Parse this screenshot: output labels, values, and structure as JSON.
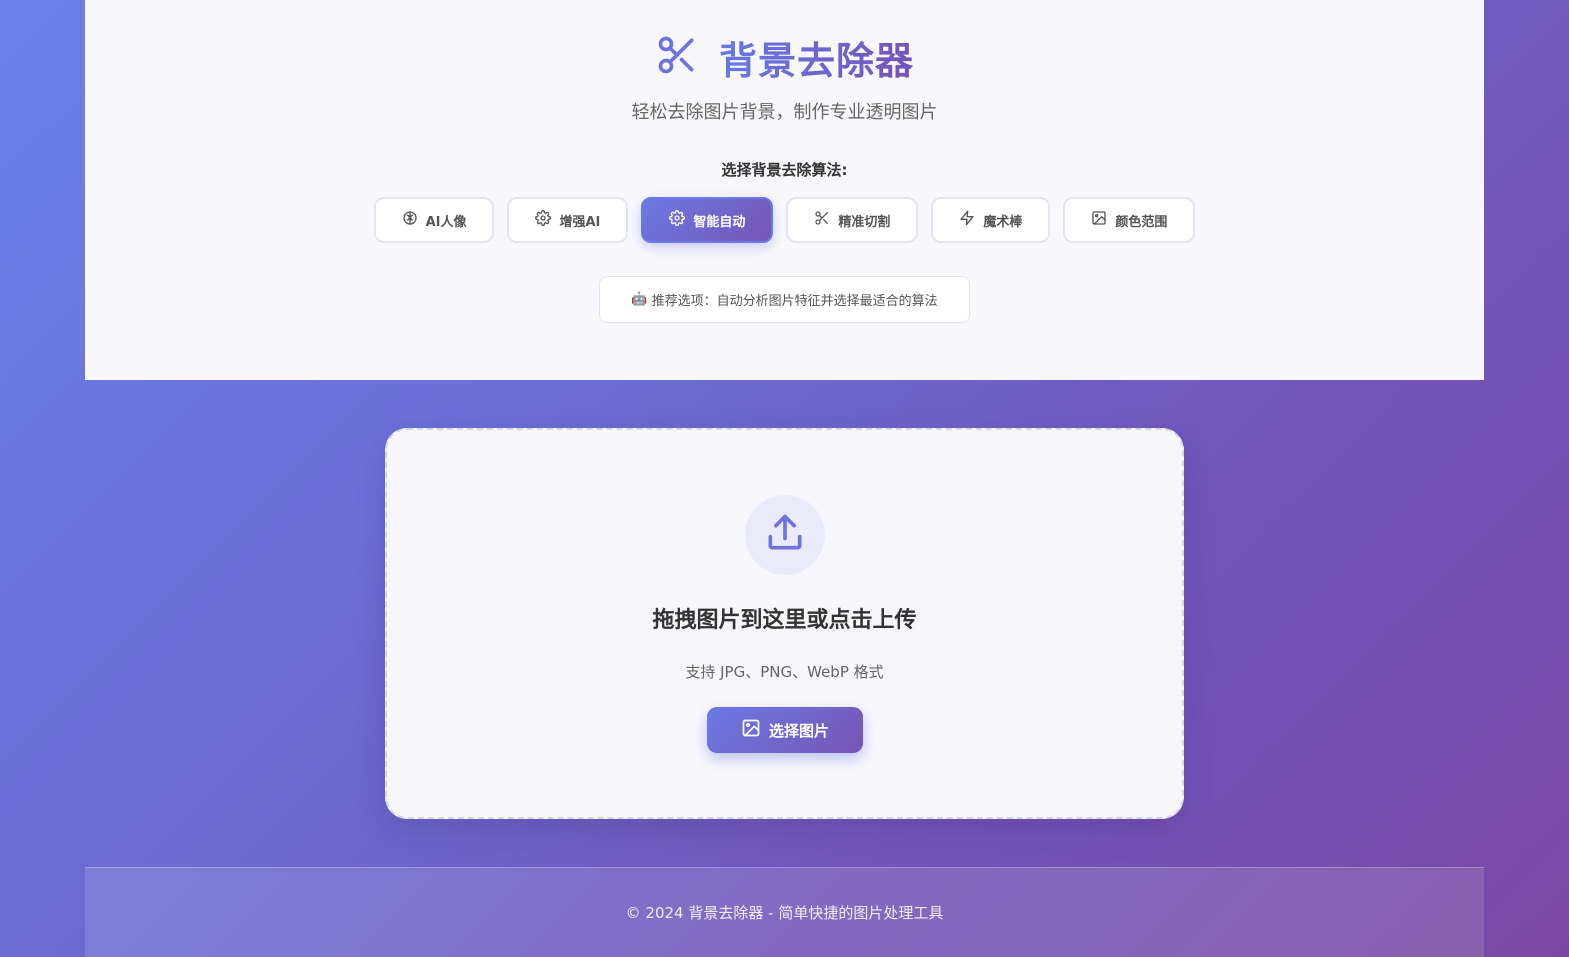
{
  "header": {
    "title": "背景去除器",
    "subtitle": "轻松去除图片背景，制作专业透明图片",
    "algo_label": "选择背景去除算法:",
    "algorithms": [
      {
        "label": "AI人像",
        "icon": "brain-icon",
        "active": false
      },
      {
        "label": "增强AI",
        "icon": "gear-icon",
        "active": false
      },
      {
        "label": "智能自动",
        "icon": "gear-icon",
        "active": true
      },
      {
        "label": "精准切割",
        "icon": "scissors-icon",
        "active": false
      },
      {
        "label": "魔术棒",
        "icon": "lightning-icon",
        "active": false
      },
      {
        "label": "颜色范围",
        "icon": "image-icon",
        "active": false
      }
    ],
    "recommend_emoji": "🤖",
    "recommend_text": "推荐选项：自动分析图片特征并选择最适合的算法"
  },
  "upload": {
    "title": "拖拽图片到这里或点击上传",
    "hint": "支持 JPG、PNG、WebP 格式",
    "button_label": "选择图片"
  },
  "footer": {
    "text": "© 2024 背景去除器 - 简单快捷的图片处理工具"
  },
  "colors": {
    "accent_start": "#6a7ae3",
    "accent_end": "#7755b6"
  }
}
